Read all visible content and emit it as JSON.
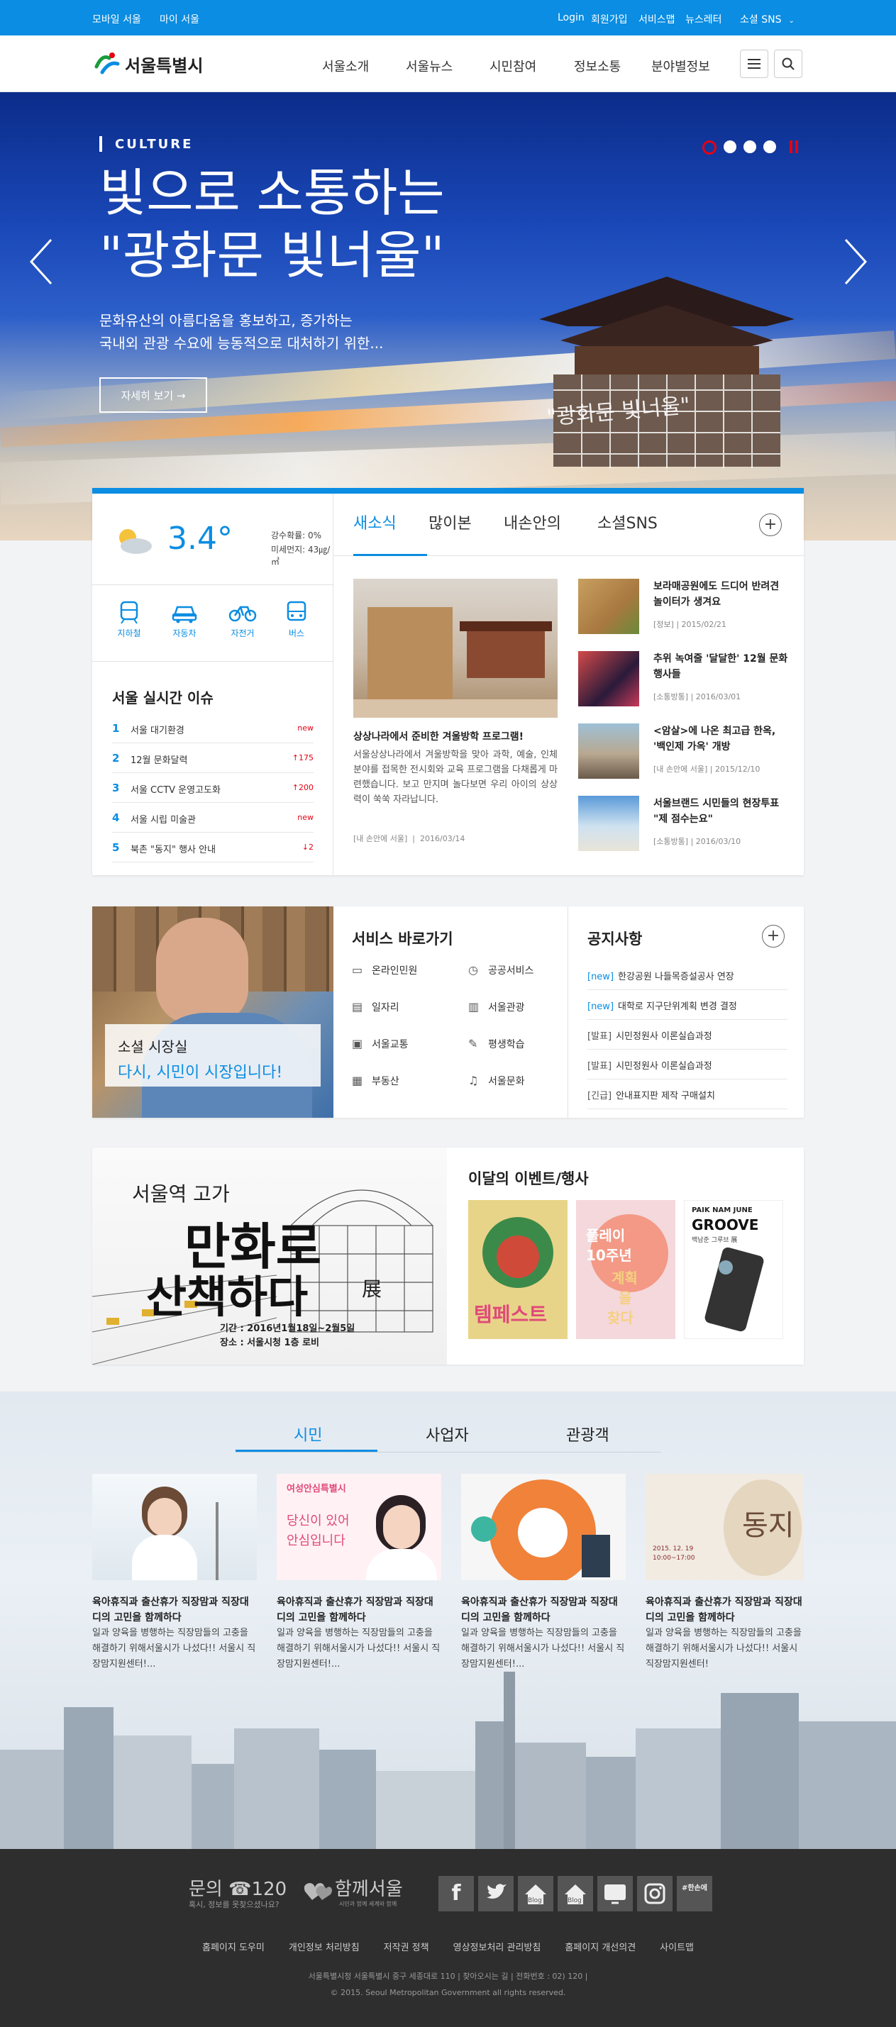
{
  "topbar": {
    "mobile": "모바일 서울",
    "my": "마이 서울",
    "login": "Login",
    "join": "회원가입",
    "service": "서비스맵",
    "newsletter": "뉴스레터",
    "sns": "소셜 SNS"
  },
  "header": {
    "logo": "서울특별시",
    "nav": [
      "서울소개",
      "서울뉴스",
      "시민참여",
      "정보소통",
      "분야별정보"
    ]
  },
  "hero": {
    "category": "CULTURE",
    "title1": "빛으로 소통하는",
    "title2": "\"광화문 빛너울\"",
    "desc1": "문화유산의 아름다움을 홍보하고, 증가하는",
    "desc2": "국내외 관광 수요에 능동적으로 대처하기 위한...",
    "more": "자세히 보기 →",
    "gate_text": "\"광화문 빛너울\""
  },
  "weather": {
    "temp": "3.4°",
    "rain": "강수확률: 0%",
    "dust": "미세먼지: 43㎍/㎥"
  },
  "transport": [
    "지하철",
    "자동차",
    "자전거",
    "버스"
  ],
  "issues": {
    "title": "서울 실시간 이슈",
    "items": [
      {
        "rank": "1",
        "text": "서울 대기환경",
        "trend": "new"
      },
      {
        "rank": "2",
        "text": "12월 문화달력",
        "trend": "↑175"
      },
      {
        "rank": "3",
        "text": "서울 CCTV 운영고도화",
        "trend": "↑200"
      },
      {
        "rank": "4",
        "text": "서울 시립 미술관",
        "trend": "new"
      },
      {
        "rank": "5",
        "text": "북촌 \"동지\" 행사 안내",
        "trend": "↓2"
      }
    ]
  },
  "news": {
    "tabs": [
      "새소식",
      "많이본",
      "내손안의",
      "소셜SNS"
    ],
    "main_title": "상상나라에서 준비한 겨울방학 프로그램!",
    "main_body": "서울상상나라에서 겨울방학을 맞아 과학, 예술, 인체 분야를 접목한 전시회와 교육 프로그램을 다채롭게 마련했습니다. 보고 만지며 놀다보면 우리 아이의 상상력이 쑥쑥 자라납니다.",
    "main_src": "[내 손안에 서울]",
    "main_date": "2016/03/14",
    "side": [
      {
        "title": "보라매공원에도 드디어 반려견 놀이터가 생겨요",
        "src": "[정보]",
        "date": "2015/02/21"
      },
      {
        "title": "추위 녹여줄 '달달한' 12월 문화행사들",
        "src": "[소통방통]",
        "date": "2016/03/01"
      },
      {
        "title": "<암살>에 나온 최고급 한옥, '백인제 가옥' 개방",
        "src": "[내 손안에 서울]",
        "date": "2015/12/10"
      },
      {
        "title": "서울브랜드 시민들의 현장투표 \"제 점수는요\"",
        "src": "[소통방통]",
        "date": "2016/03/10"
      }
    ]
  },
  "mayor": {
    "title": "소셜 시장실",
    "sub": "다시, 시민이 시장입니다!"
  },
  "services": {
    "title": "서비스 바로가기",
    "items": [
      "온라인민원",
      "공공서비스",
      "일자리",
      "서울관광",
      "서울교통",
      "평생학습",
      "부동산",
      "서울문화"
    ]
  },
  "notice": {
    "title": "공지사항",
    "items": [
      {
        "tag": "[new]",
        "text": "한강공원 나들목증설공사 연장"
      },
      {
        "tag": "[new]",
        "text": "대학로 지구단위계획 변경 결정"
      },
      {
        "tag": "[발표]",
        "text": "시민정원사 이론실습과정"
      },
      {
        "tag": "[발표]",
        "text": "시민정원사 이론실습과정"
      },
      {
        "tag": "[긴급]",
        "text": "안내표지판 제작 구매설치"
      }
    ]
  },
  "banner": {
    "head": "서울역 고가",
    "big1": "만화로",
    "big2": "산책하다",
    "tail": "展",
    "period": "기간 : 2016년1월18일~2월5일",
    "place": "장소 : 서울시청 1층 로비"
  },
  "events": {
    "title": "이달의 이벤트/행사",
    "poster1": "템페스트",
    "poster2a": "플레이",
    "poster2b": "10주년",
    "poster2c": "계획",
    "poster2d": "을",
    "poster2e": "찾다",
    "poster3a": "PAIK NAM JUNE",
    "poster3b": "GROOVE",
    "poster3c": "백남준 그루브 展"
  },
  "audience": {
    "tabs": [
      "시민",
      "사업자",
      "관광객"
    ],
    "cards": [
      {
        "title": "육아휴직과 출산휴가 직장맘과 직장대디의 고민을 함께하다",
        "body": "일과 양육을 병행하는 직장맘들의 고충을 해결하기 위해서울시가 나섰다!! 서울시 직장맘지원센터!..."
      },
      {
        "title": "육아휴직과 출산휴가 직장맘과 직장대디의 고민을 함께하다",
        "body": "일과 양육을 병행하는 직장맘들의 고충을 해결하기 위해서울시가 나섰다!! 서울시 직장맘지원센터!..."
      },
      {
        "title": "육아휴직과 출산휴가 직장맘과 직장대디의 고민을 함께하다",
        "body": "일과 양육을 병행하는 직장맘들의 고충을 해결하기 위해서울시가 나섰다!! 서울시 직장맘지원센터!..."
      },
      {
        "title": "육아휴직과 출산휴가 직장맘과 직장대디의 고민을 함께하다",
        "body": "일과 양육을 병행하는 직장맘들의 고충을 해결하기 위해서울시가 나섰다!! 서울시 직장맘지원센터!"
      }
    ],
    "card2_badge": "여성안심특별시",
    "card2_text1": "당신이 있어",
    "card2_text2": "안심입니다",
    "card4_text": "동지",
    "card4_date": "2015. 12. 19 10:00~17:00"
  },
  "footer": {
    "contact_label": "문의",
    "contact_num": "☎120",
    "contact_sub": "혹시, 정보를 못찾으셨나요?",
    "together": "함께서울",
    "together_sub": "시민과 함께 세계와 함께",
    "blog": "Blog",
    "hashtag": "#한손에",
    "links": [
      "홈페이지 도우미",
      "개인정보 처리방침",
      "저작권 정책",
      "영상정보처리 관리방침",
      "홈페이지 개선의견",
      "사이트맵"
    ],
    "address": "서울특별시청 서울특별시 중구 세종대로 110  |  찾아오시는 길  |  전화번호 : 02) 120  |",
    "copy": "© 2015. Seoul Metropolitan Government all rights reserved."
  }
}
